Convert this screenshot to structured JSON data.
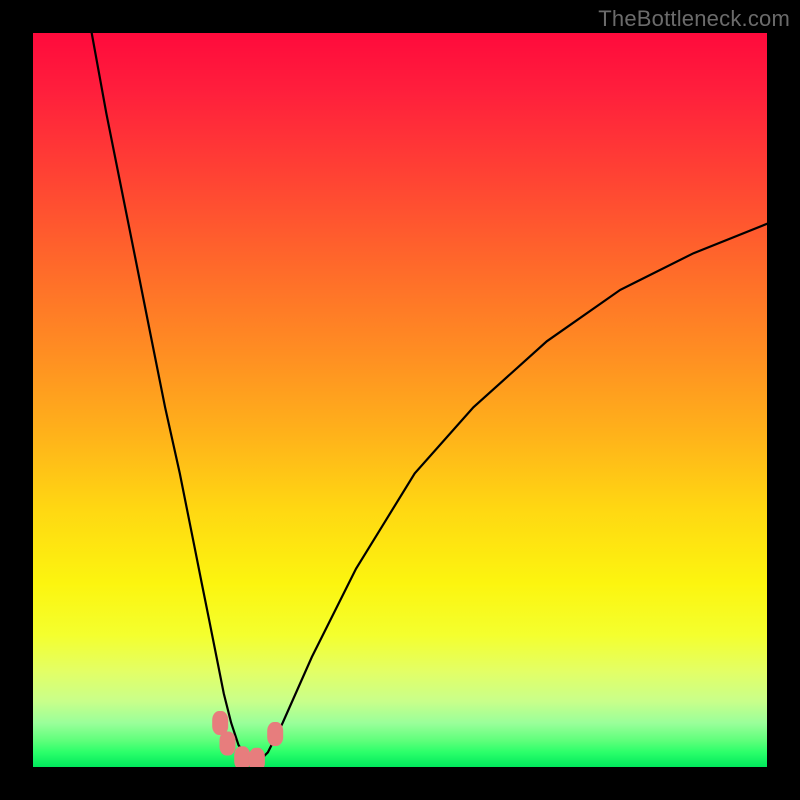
{
  "watermark": "TheBottleneck.com",
  "chart_data": {
    "type": "line",
    "title": "",
    "xlabel": "",
    "ylabel": "",
    "xlim": [
      0,
      100
    ],
    "ylim": [
      0,
      100
    ],
    "grid": false,
    "series": [
      {
        "name": "curve",
        "color": "#000000",
        "x": [
          8,
          10,
          12,
          14,
          16,
          18,
          20,
          22,
          23,
          24,
          25,
          26,
          27,
          28,
          29,
          30,
          31,
          32,
          34,
          38,
          44,
          52,
          60,
          70,
          80,
          90,
          100
        ],
        "y": [
          100,
          89,
          79,
          69,
          59,
          49,
          40,
          30,
          25,
          20,
          15,
          10,
          6,
          3,
          1.5,
          1,
          1,
          2,
          6,
          15,
          27,
          40,
          49,
          58,
          65,
          70,
          74
        ]
      }
    ],
    "markers": [
      {
        "shape": "rounded",
        "cx": 25.5,
        "cy": 6.0,
        "color": "#e77d7d"
      },
      {
        "shape": "rounded",
        "cx": 26.5,
        "cy": 3.2,
        "color": "#e77d7d"
      },
      {
        "shape": "rounded",
        "cx": 28.5,
        "cy": 1.2,
        "color": "#e77d7d"
      },
      {
        "shape": "rounded",
        "cx": 30.5,
        "cy": 1.0,
        "color": "#e77d7d"
      },
      {
        "shape": "rounded",
        "cx": 33.0,
        "cy": 4.5,
        "color": "#e77d7d"
      }
    ],
    "background_gradient": {
      "direction": "vertical",
      "stops": [
        {
          "at": 0,
          "color": "#ff0a3c"
        },
        {
          "at": 50,
          "color": "#ffb31a"
        },
        {
          "at": 80,
          "color": "#f4ff2e"
        },
        {
          "at": 100,
          "color": "#00e85c"
        }
      ]
    }
  }
}
